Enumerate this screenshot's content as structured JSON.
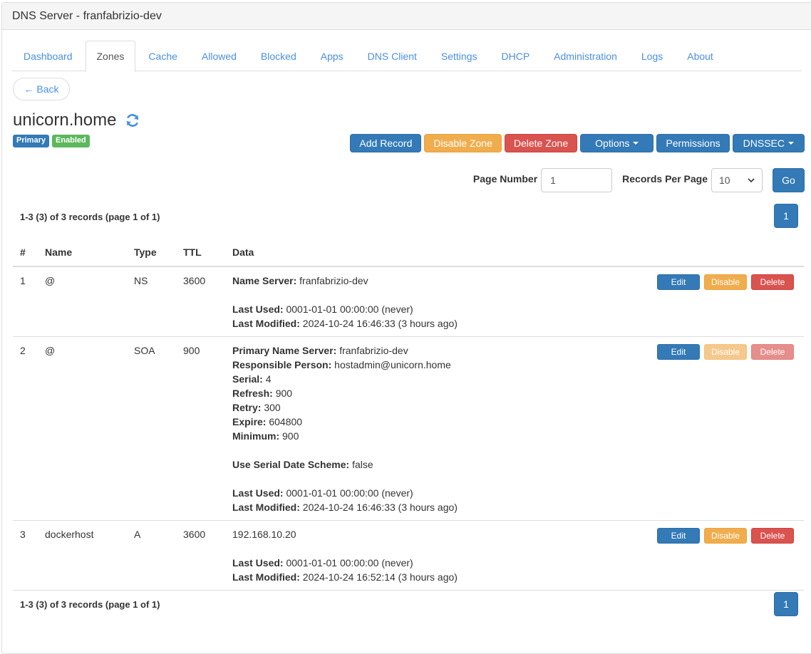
{
  "app": {
    "title": "DNS Server - franfabrizio-dev"
  },
  "tabs": [
    {
      "label": "Dashboard",
      "active": false
    },
    {
      "label": "Zones",
      "active": true
    },
    {
      "label": "Cache",
      "active": false
    },
    {
      "label": "Allowed",
      "active": false
    },
    {
      "label": "Blocked",
      "active": false
    },
    {
      "label": "Apps",
      "active": false
    },
    {
      "label": "DNS Client",
      "active": false
    },
    {
      "label": "Settings",
      "active": false
    },
    {
      "label": "DHCP",
      "active": false
    },
    {
      "label": "Administration",
      "active": false
    },
    {
      "label": "Logs",
      "active": false
    },
    {
      "label": "About",
      "active": false
    }
  ],
  "back_label": "← Back",
  "zone": {
    "name": "unicorn.home",
    "refresh_icon": "refresh-icon",
    "badges": {
      "type": "Primary",
      "status": "Enabled"
    }
  },
  "zone_actions": {
    "add_record": "Add Record",
    "disable_zone": "Disable Zone",
    "delete_zone": "Delete Zone",
    "options": "Options",
    "permissions": "Permissions",
    "dnssec": "DNSSEC"
  },
  "pager": {
    "page_number_label": "Page Number",
    "page_number_value": "1",
    "records_per_page_label": "Records Per Page",
    "records_per_page_value": "10",
    "go_label": "Go",
    "summary": "1-3 (3) of 3 records (page 1 of 1)",
    "current_page": "1"
  },
  "colors": {
    "primary": "#337ab7",
    "warning": "#f0ad4e",
    "danger": "#d9534f",
    "success": "#5cb85c",
    "link": "#4a8fe2"
  },
  "table": {
    "headers": {
      "num": "#",
      "name": "Name",
      "type": "Type",
      "ttl": "TTL",
      "data": "Data"
    },
    "action_labels": {
      "edit": "Edit",
      "disable": "Disable",
      "delete": "Delete"
    },
    "rows": [
      {
        "num": "1",
        "name": "@",
        "type": "NS",
        "ttl": "3600",
        "data": [
          {
            "label": "Name Server:",
            "value": "franfabrizio-dev"
          },
          null,
          {
            "label": "Last Used:",
            "value": "0001-01-01 00:00:00 (never)"
          },
          {
            "label": "Last Modified:",
            "value": "2024-10-24 16:46:33 (3 hours ago)"
          }
        ],
        "actions_disabled": false
      },
      {
        "num": "2",
        "name": "@",
        "type": "SOA",
        "ttl": "900",
        "data": [
          {
            "label": "Primary Name Server:",
            "value": "franfabrizio-dev"
          },
          {
            "label": "Responsible Person:",
            "value": "hostadmin@unicorn.home"
          },
          {
            "label": "Serial:",
            "value": "4"
          },
          {
            "label": "Refresh:",
            "value": "900"
          },
          {
            "label": "Retry:",
            "value": "300"
          },
          {
            "label": "Expire:",
            "value": "604800"
          },
          {
            "label": "Minimum:",
            "value": "900"
          },
          null,
          {
            "label": "Use Serial Date Scheme:",
            "value": "false"
          },
          null,
          {
            "label": "Last Used:",
            "value": "0001-01-01 00:00:00 (never)"
          },
          {
            "label": "Last Modified:",
            "value": "2024-10-24 16:46:33 (3 hours ago)"
          }
        ],
        "actions_disabled": true
      },
      {
        "num": "3",
        "name": "dockerhost",
        "type": "A",
        "ttl": "3600",
        "data": [
          {
            "label": "",
            "value": "192.168.10.20"
          },
          null,
          {
            "label": "Last Used:",
            "value": "0001-01-01 00:00:00 (never)"
          },
          {
            "label": "Last Modified:",
            "value": "2024-10-24 16:52:14 (3 hours ago)"
          }
        ],
        "actions_disabled": false
      }
    ]
  }
}
